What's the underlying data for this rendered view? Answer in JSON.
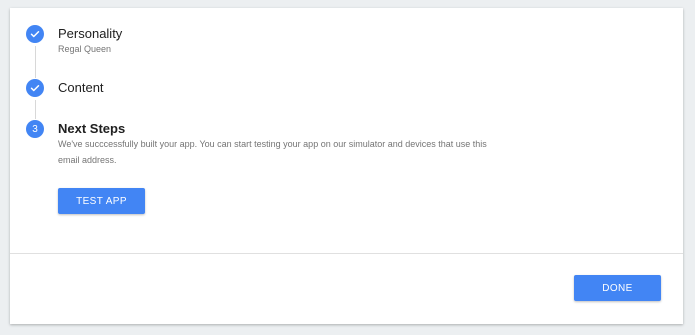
{
  "stepper": {
    "steps": [
      {
        "state": "complete",
        "title": "Personality",
        "subtitle": "Regal Queen"
      },
      {
        "state": "complete",
        "title": "Content"
      },
      {
        "state": "active",
        "number": "3",
        "title": "Next Steps",
        "description": "We've succcessfully built your app. You can start testing your app on our simulator and devices that use this email address.",
        "action_label": "TEST APP"
      }
    ]
  },
  "footer": {
    "done_label": "DONE"
  },
  "colors": {
    "accent": "#4285f4",
    "background": "#eceff1",
    "card": "#ffffff"
  }
}
